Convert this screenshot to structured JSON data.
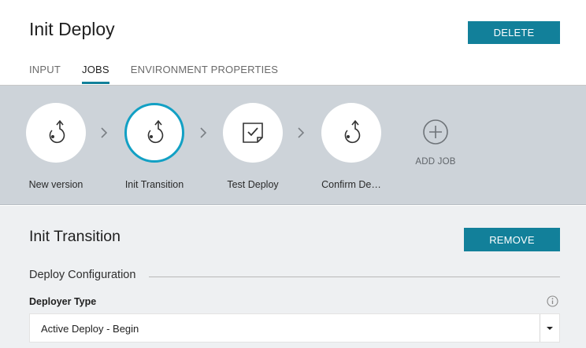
{
  "header": {
    "title": "Init Deploy",
    "delete_label": "DELETE",
    "tabs": [
      {
        "label": "INPUT",
        "active": false
      },
      {
        "label": "JOBS",
        "active": true
      },
      {
        "label": "ENVIRONMENT PROPERTIES",
        "active": false
      }
    ]
  },
  "pipeline": {
    "jobs": [
      {
        "label": "New version",
        "icon": "deploy-icon",
        "selected": false
      },
      {
        "label": "Init Transition",
        "icon": "deploy-icon",
        "selected": true
      },
      {
        "label": "Test Deploy",
        "icon": "test-checkbox-icon",
        "selected": false
      },
      {
        "label": "Confirm De…",
        "icon": "deploy-icon",
        "selected": false
      }
    ],
    "separator_icon": "chevron-right-icon",
    "add_job_label": "ADD JOB",
    "add_job_icon": "plus-circle-icon"
  },
  "detail": {
    "title": "Init Transition",
    "remove_label": "REMOVE",
    "section_heading": "Deploy Configuration",
    "field_label": "Deployer Type",
    "field_value": "Active Deploy - Begin",
    "info_icon": "info-icon",
    "dropdown_icon": "caret-down-icon"
  },
  "colors": {
    "accent": "#12809a",
    "selected_ring": "#12a0c4",
    "pipeline_bg": "#cdd3d9",
    "detail_bg": "#eef0f2"
  }
}
